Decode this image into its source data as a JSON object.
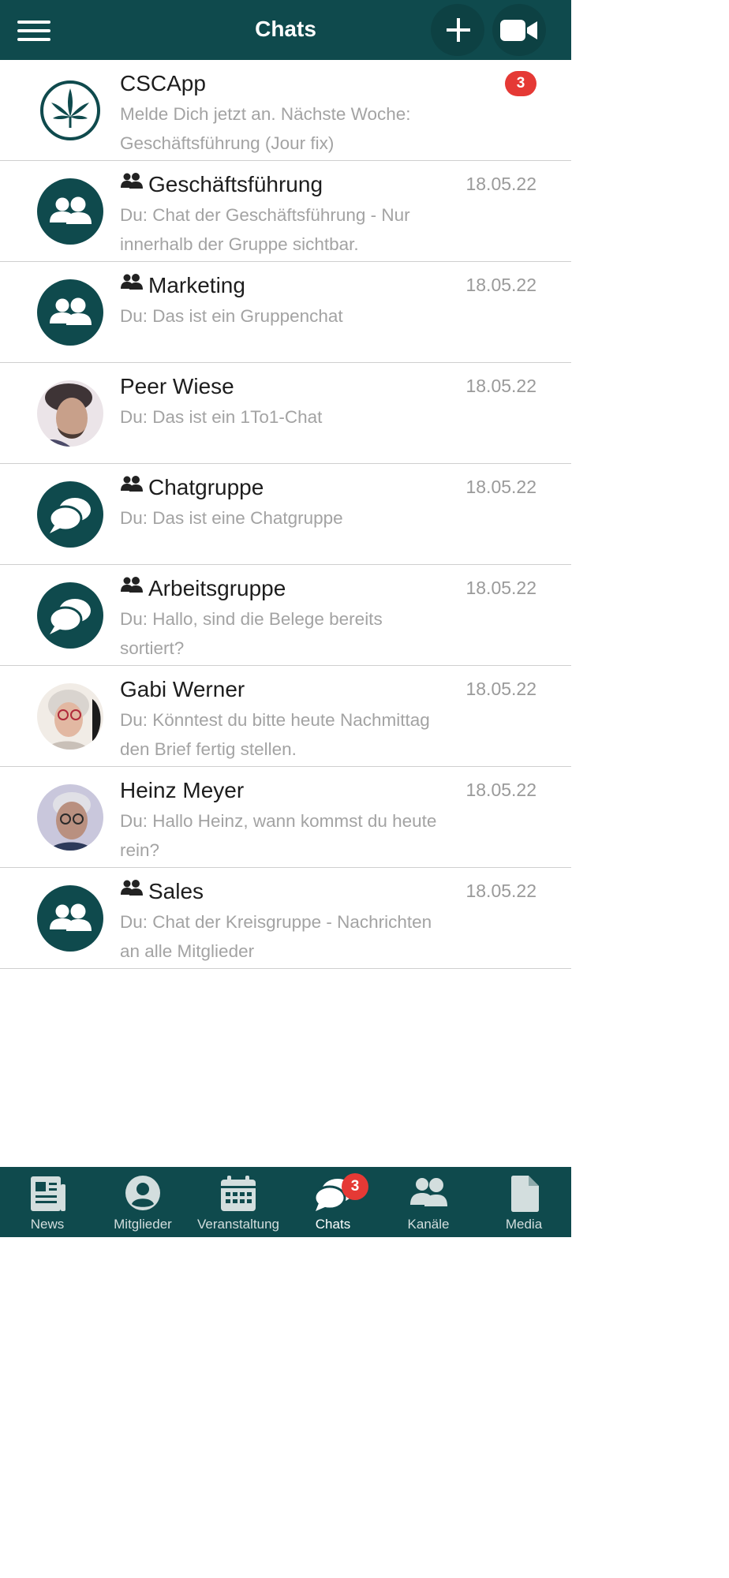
{
  "header": {
    "title": "Chats",
    "menu_icon": "hamburger-menu-icon",
    "add_icon": "plus-icon",
    "video_icon": "video-camera-icon",
    "background": "#0f4a4d"
  },
  "chats": [
    {
      "name": "CSCApp",
      "group": false,
      "avatar": "cannabis-logo",
      "preview": "Melde Dich jetzt an. Nächste Woche: Geschäftsführung (Jour fix)",
      "date": "",
      "unread": "3"
    },
    {
      "name": "Geschäftsführung",
      "group": true,
      "avatar": "group-people-icon",
      "preview": "Du: Chat der Geschäftsführung - Nur innerhalb der Gruppe sichtbar.",
      "date": "18.05.22"
    },
    {
      "name": "Marketing",
      "group": true,
      "avatar": "group-people-icon",
      "preview": "Du: Das ist ein Gruppenchat",
      "date": "18.05.22"
    },
    {
      "name": "Peer Wiese",
      "group": false,
      "avatar": "photo-peer",
      "preview": "Du: Das ist ein 1To1-Chat",
      "date": "18.05.22"
    },
    {
      "name": "Chatgruppe",
      "group": true,
      "avatar": "speech-bubbles-icon",
      "preview": "Du: Das ist eine Chatgruppe",
      "date": "18.05.22"
    },
    {
      "name": "Arbeitsgruppe",
      "group": true,
      "avatar": "speech-bubbles-icon",
      "preview": "Du: Hallo, sind die Belege bereits sortiert?",
      "date": "18.05.22"
    },
    {
      "name": "Gabi Werner",
      "group": false,
      "avatar": "photo-gabi",
      "preview": "Du: Könntest du bitte heute Nachmittag den Brief fertig stellen.",
      "date": "18.05.22"
    },
    {
      "name": "Heinz Meyer",
      "group": false,
      "avatar": "photo-heinz",
      "preview": "Du: Hallo Heinz, wann kommst du heute rein?",
      "date": "18.05.22"
    },
    {
      "name": "Sales",
      "group": true,
      "avatar": "group-people-icon",
      "preview": "Du: Chat der Kreisgruppe - Nachrichten an alle Mitglieder",
      "date": "18.05.22"
    }
  ],
  "tabs": [
    {
      "label": "News",
      "icon": "newspaper-icon"
    },
    {
      "label": "Mitglieder",
      "icon": "user-circle-icon"
    },
    {
      "label": "Veranstaltung",
      "icon": "calendar-icon"
    },
    {
      "label": "Chats",
      "icon": "chat-bubbles-icon",
      "active": true,
      "badge": "3"
    },
    {
      "label": "Kanäle",
      "icon": "users-icon"
    },
    {
      "label": "Media",
      "icon": "file-icon"
    }
  ],
  "colors": {
    "accent": "#0f4a4d",
    "badge": "#e53935",
    "muted_text": "#a3a3a3"
  }
}
